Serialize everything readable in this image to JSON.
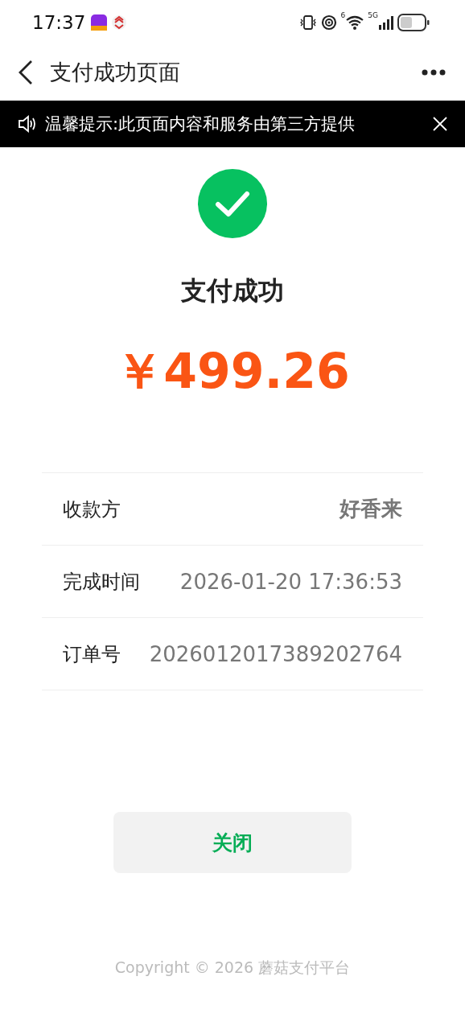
{
  "status_bar": {
    "time": "17:37",
    "wifi_badge": "6",
    "network": "5G"
  },
  "nav": {
    "title": "支付成功页面"
  },
  "notice": {
    "text": "温馨提示:此页面内容和服务由第三方提供"
  },
  "result": {
    "title": "支付成功",
    "amount": "￥499.26"
  },
  "details": [
    {
      "label": "收款方",
      "value": "好香来",
      "kind": "bold"
    },
    {
      "label": "完成时间",
      "value": "2026-01-20 17:36:53",
      "kind": "plain"
    },
    {
      "label": "订单号",
      "value": "2026012017389202764",
      "kind": "plain"
    }
  ],
  "close_button": "关闭",
  "footer": "Copyright © 2026 蘑菇支付平台"
}
